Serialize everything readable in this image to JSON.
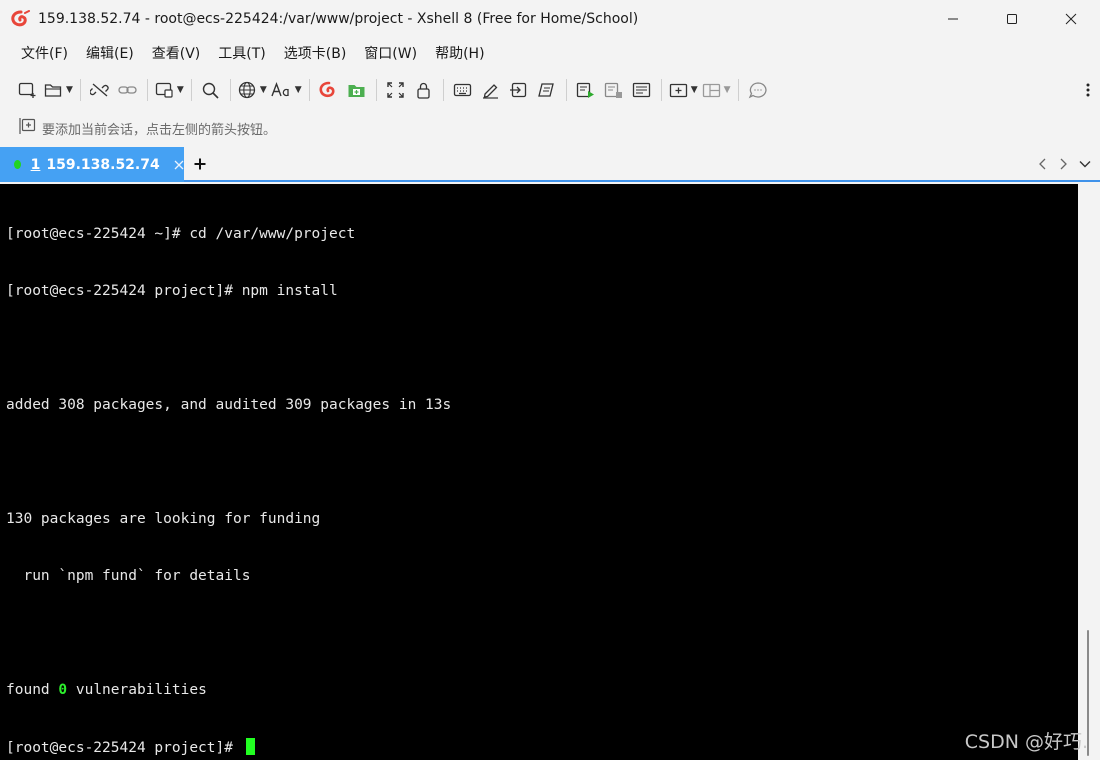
{
  "window": {
    "title": "159.138.52.74 - root@ecs-225424:/var/www/project - Xshell 8 (Free for Home/School)"
  },
  "menu": {
    "items": [
      "文件(F)",
      "编辑(E)",
      "查看(V)",
      "工具(T)",
      "选项卡(B)",
      "窗口(W)",
      "帮助(H)"
    ]
  },
  "addressbar": {
    "hint": "要添加当前会话，点击左侧的箭头按钮。"
  },
  "tabs": {
    "active": {
      "number": "1",
      "label": "159.138.52.74",
      "status_color": "#22d322"
    }
  },
  "terminal": {
    "lines": [
      "[root@ecs-225424 ~]# cd /var/www/project",
      "[root@ecs-225424 project]# npm install",
      "",
      "added 308 packages, and audited 309 packages in 13s",
      "",
      "130 packages are looking for funding",
      "  run `npm fund` for details",
      ""
    ],
    "found_prefix": "found ",
    "found_count": "0",
    "found_suffix": " vulnerabilities",
    "prompt": "[root@ecs-225424 project]# "
  },
  "watermark": "CSDN @好巧."
}
